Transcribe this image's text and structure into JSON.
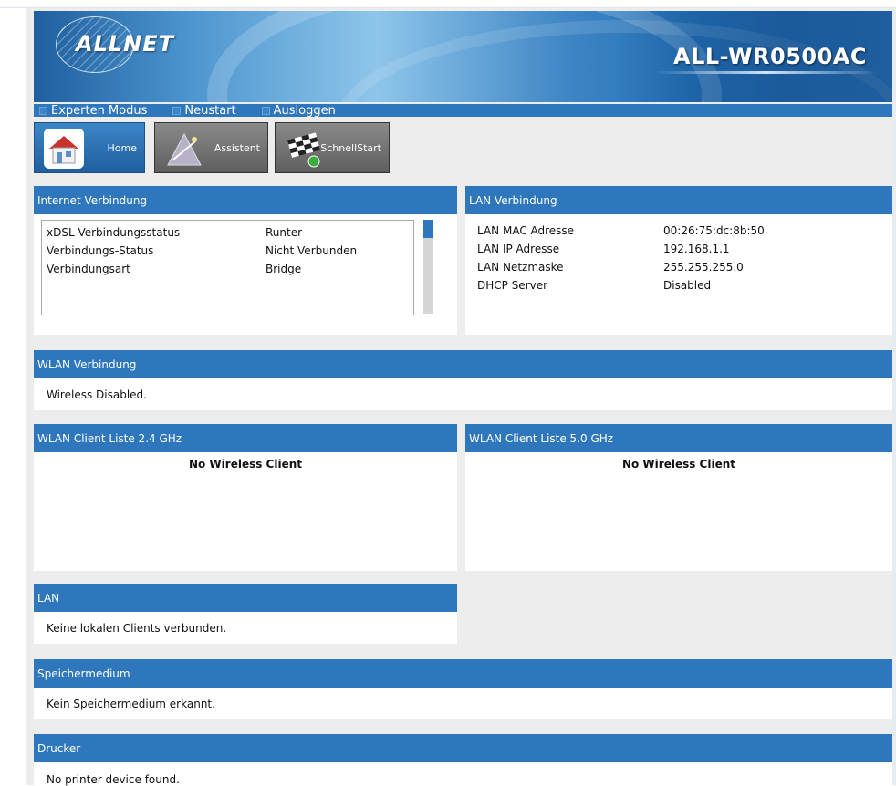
{
  "header": {
    "brand": "ALLNET",
    "model": "ALL-WR0500AC"
  },
  "menu": [
    {
      "label": "Experten Modus"
    },
    {
      "label": "Neustart"
    },
    {
      "label": "Ausloggen"
    }
  ],
  "quick_buttons": [
    {
      "label": "Home",
      "icon": "house-icon"
    },
    {
      "label": "Assistent",
      "icon": "wizard-icon"
    },
    {
      "label": "SchnellStart",
      "icon": "checkered-flag-icon"
    }
  ],
  "internet": {
    "title": "Internet Verbindung",
    "rows": [
      {
        "key": "xDSL Verbindungsstatus",
        "value": "Runter"
      },
      {
        "key": "Verbindungs-Status",
        "value": "Nicht Verbunden"
      },
      {
        "key": "Verbindungsart",
        "value": "Bridge"
      }
    ]
  },
  "lan_connection": {
    "title": "LAN Verbindung",
    "rows": [
      {
        "key": "LAN MAC Adresse",
        "value": "00:26:75:dc:8b:50"
      },
      {
        "key": "LAN IP Adresse",
        "value": "192.168.1.1"
      },
      {
        "key": "LAN Netzmaske",
        "value": "255.255.255.0"
      },
      {
        "key": "DHCP Server",
        "value": "Disabled"
      }
    ]
  },
  "wlan": {
    "title": "WLAN Verbindung",
    "message": "Wireless Disabled."
  },
  "client_24": {
    "title": "WLAN Client Liste 2.4 GHz",
    "message": "No Wireless Client"
  },
  "client_50": {
    "title": "WLAN Client Liste 5.0 GHz",
    "message": "No Wireless Client"
  },
  "lan": {
    "title": "LAN",
    "message": "Keine lokalen Clients verbunden."
  },
  "storage": {
    "title": "Speichermedium",
    "message": "Kein Speichermedium erkannt."
  },
  "printer": {
    "title": "Drucker",
    "message": "No printer device found."
  },
  "colors": {
    "accent": "#2f77bd",
    "background": "#ededed"
  }
}
